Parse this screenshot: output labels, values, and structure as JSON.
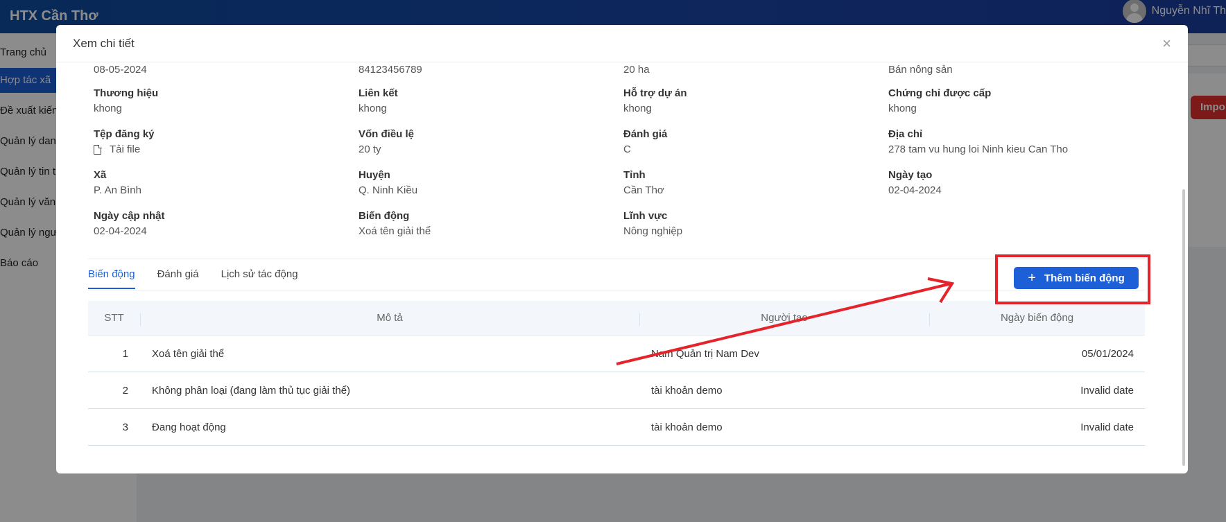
{
  "app": {
    "brand": "HTX Cần Thơ",
    "user_name": "Nguyễn Nhĩ Th",
    "import_label": "Impo",
    "sidebar": [
      {
        "label": "Trang chủ",
        "active": false
      },
      {
        "label": "Hợp tác xã",
        "active": true
      },
      {
        "label": "Đề xuất kiến",
        "active": false
      },
      {
        "label": "Quản lý dan",
        "active": false
      },
      {
        "label": "Quản lý tin t",
        "active": false
      },
      {
        "label": "Quản lý văn",
        "active": false
      },
      {
        "label": "Quản lý ngư",
        "active": false
      },
      {
        "label": "Báo cáo",
        "active": false
      }
    ]
  },
  "modal": {
    "title": "Xem chi tiết",
    "close": "×",
    "partial_row": [
      "08-05-2024",
      "84123456789",
      "20 ha",
      "Bán nông sản"
    ],
    "fields": [
      [
        {
          "label": "Thương hiệu",
          "value": "khong"
        },
        {
          "label": "Liên kết",
          "value": "khong"
        },
        {
          "label": "Hỗ trợ dự án",
          "value": "khong"
        },
        {
          "label": "Chứng chỉ được cấp",
          "value": "khong"
        }
      ],
      [
        {
          "label": "Tệp đăng ký",
          "value": "Tải file"
        },
        {
          "label": "Vốn điều lệ",
          "value": "20 ty"
        },
        {
          "label": "Đánh giá",
          "value": "C"
        },
        {
          "label": "Địa chỉ",
          "value": "278 tam vu hung loi Ninh kieu Can Tho"
        }
      ],
      [
        {
          "label": "Xã",
          "value": "P. An Bình"
        },
        {
          "label": "Huyện",
          "value": "Q. Ninh Kiều"
        },
        {
          "label": "Tỉnh",
          "value": "Cần Thơ"
        },
        {
          "label": "Ngày tạo",
          "value": "02-04-2024"
        }
      ],
      [
        {
          "label": "Ngày cập nhật",
          "value": "02-04-2024"
        },
        {
          "label": "Biến động",
          "value": "Xoá tên giải thể"
        },
        {
          "label": "Lĩnh vực",
          "value": "Nông nghiệp"
        }
      ]
    ],
    "tabs": [
      {
        "label": "Biến động",
        "active": true
      },
      {
        "label": "Đánh giá",
        "active": false
      },
      {
        "label": "Lịch sử tác động",
        "active": false
      }
    ],
    "add_button": "Thêm biến động",
    "table": {
      "headers": [
        "STT",
        "Mô tả",
        "Người tạo",
        "Ngày biến động"
      ],
      "rows": [
        [
          "1",
          "Xoá tên giải thể",
          "Nam Quản trị Nam Dev",
          "05/01/2024"
        ],
        [
          "2",
          "Không phân loại (đang làm thủ tục giải thể)",
          "tài khoản demo",
          "Invalid date"
        ],
        [
          "3",
          "Đang hoạt động",
          "tài khoản demo",
          "Invalid date"
        ]
      ]
    }
  },
  "colors": {
    "primary": "#1c5fd6",
    "annotation": "#e5232b"
  }
}
